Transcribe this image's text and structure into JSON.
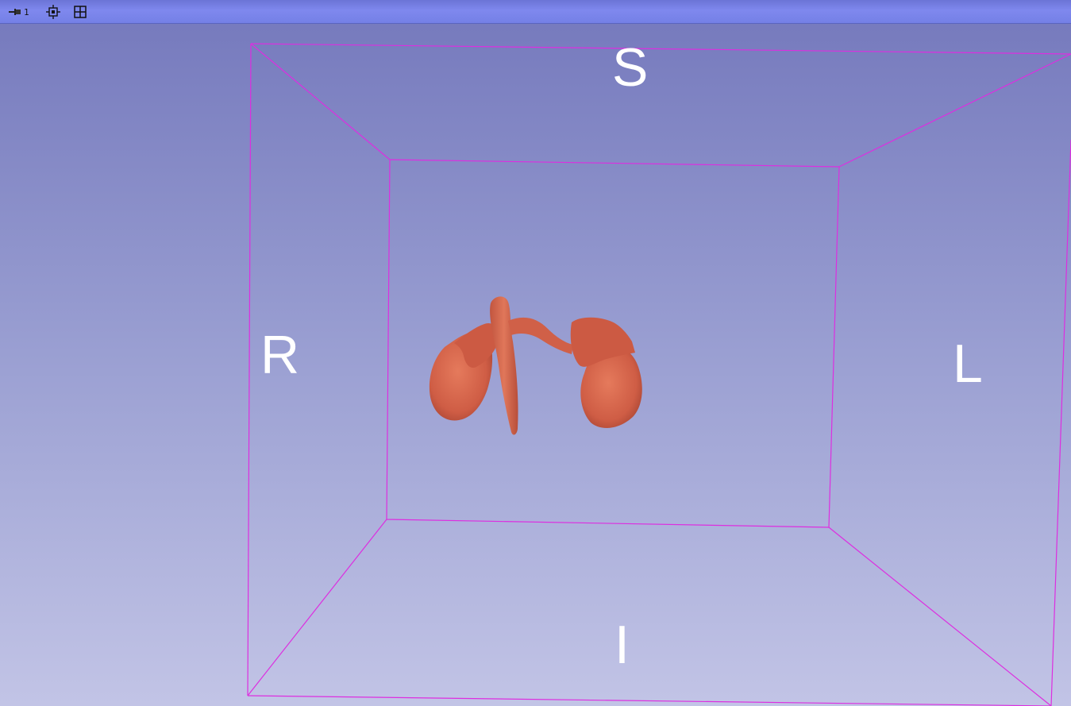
{
  "toolbar": {
    "pin_icon": "pin-icon",
    "view_number": "1",
    "center_icon": "center-view-icon",
    "layout_icon": "layout-grid-icon"
  },
  "view": {
    "orientation_labels": {
      "superior": "S",
      "inferior": "I",
      "right": "R",
      "left": "L"
    },
    "background_top": "#7478bc",
    "background_bottom": "#c2c4e6",
    "box_color": "#dd2ee0",
    "model_color": "#d2624a"
  }
}
